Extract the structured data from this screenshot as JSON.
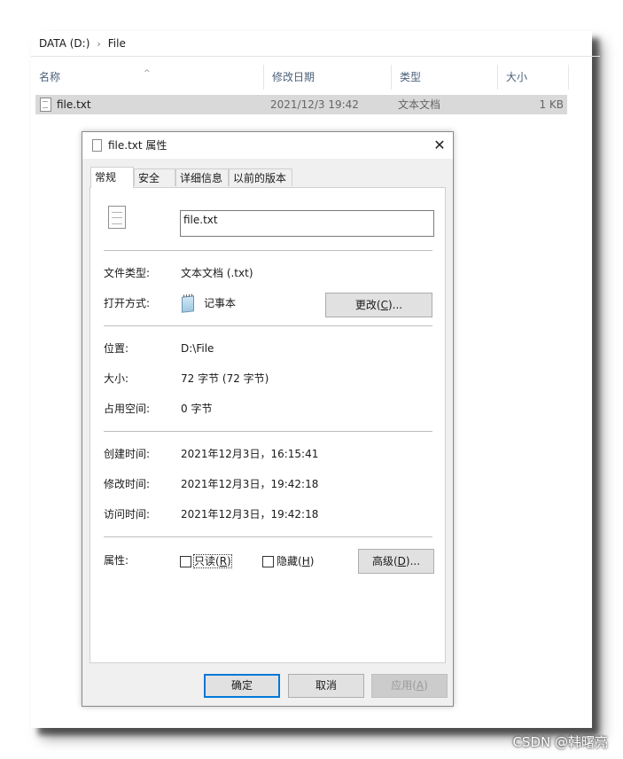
{
  "explorer": {
    "breadcrumb": [
      "DATA (D:)",
      "File"
    ],
    "breadcrumb_sep": "›",
    "columns": [
      "名称",
      "修改日期",
      "类型",
      "大小"
    ],
    "sort_indicator": "^",
    "file": {
      "name": "file.txt",
      "modified": "2021/12/3 19:42",
      "type": "文本文档",
      "size": "1 KB"
    }
  },
  "dialog": {
    "title": "file.txt 属性",
    "close": "✕",
    "tabs": [
      "常规",
      "安全",
      "详细信息",
      "以前的版本"
    ],
    "active_tab": "常规",
    "filename": "file.txt",
    "file_type_label": "文件类型:",
    "file_type_value": "文本文档 (.txt)",
    "open_with_label": "打开方式:",
    "open_with_value": "记事本",
    "change_button": {
      "prefix": "更改(",
      "mnemonic": "C",
      "suffix": ")..."
    },
    "location_label": "位置:",
    "location_value": "D:\\File",
    "size_label": "大小:",
    "size_value": "72 字节 (72 字节)",
    "disk_size_label": "占用空间:",
    "disk_size_value": "0 字节",
    "created_label": "创建时间:",
    "created_value": "2021年12月3日，16:15:41",
    "modified_label": "修改时间:",
    "modified_value": "2021年12月3日，19:42:18",
    "accessed_label": "访问时间:",
    "accessed_value": "2021年12月3日，19:42:18",
    "attributes_label": "属性:",
    "readonly": {
      "prefix": "只读(",
      "mnemonic": "R",
      "suffix": ")",
      "checked": false
    },
    "hidden": {
      "prefix": "隐藏(",
      "mnemonic": "H",
      "suffix": ")",
      "checked": false
    },
    "advanced_button": {
      "prefix": "高级(",
      "mnemonic": "D",
      "suffix": ")..."
    },
    "ok_button": "确定",
    "cancel_button": "取消",
    "apply_button": {
      "prefix": "应用(",
      "mnemonic": "A",
      "suffix": ")",
      "disabled": true
    }
  },
  "watermark": "CSDN @韩曙亮",
  "colors": {
    "selection": "#d9d9d9",
    "dialog_bg": "#f0f0f0",
    "button_bg": "#e1e1e1",
    "ok_border": "#0078d7",
    "header_text": "#4c607a"
  }
}
